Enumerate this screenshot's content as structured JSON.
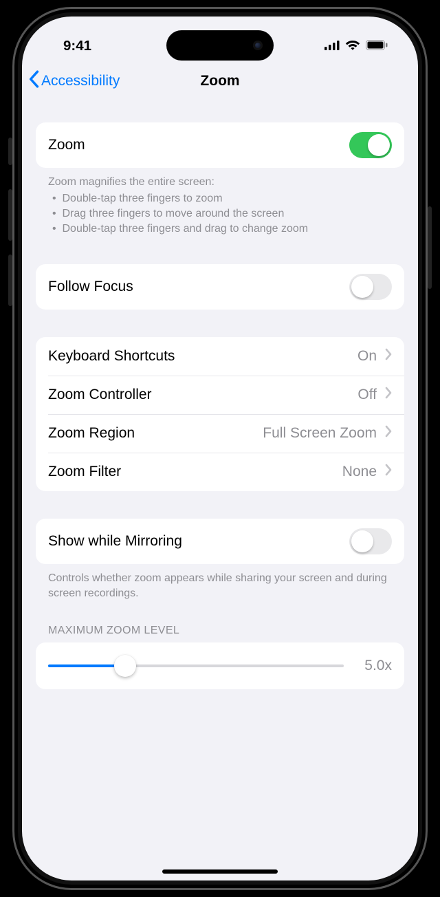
{
  "status": {
    "time": "9:41"
  },
  "nav": {
    "back_label": "Accessibility",
    "title": "Zoom"
  },
  "group1": {
    "zoom": {
      "label": "Zoom",
      "on": true
    },
    "desc_heading": "Zoom magnifies the entire screen:",
    "desc_items": [
      "Double-tap three fingers to zoom",
      "Drag three fingers to move around the screen",
      "Double-tap three fingers and drag to change zoom"
    ]
  },
  "group2": {
    "follow_focus": {
      "label": "Follow Focus",
      "on": false
    }
  },
  "group3": {
    "keyboard_shortcuts": {
      "label": "Keyboard Shortcuts",
      "value": "On"
    },
    "zoom_controller": {
      "label": "Zoom Controller",
      "value": "Off"
    },
    "zoom_region": {
      "label": "Zoom Region",
      "value": "Full Screen Zoom"
    },
    "zoom_filter": {
      "label": "Zoom Filter",
      "value": "None"
    }
  },
  "group4": {
    "mirroring": {
      "label": "Show while Mirroring",
      "on": false
    },
    "desc": "Controls whether zoom appears while sharing your screen and during screen recordings."
  },
  "max_zoom": {
    "header": "MAXIMUM ZOOM LEVEL",
    "value_label": "5.0x",
    "percent": 26
  }
}
